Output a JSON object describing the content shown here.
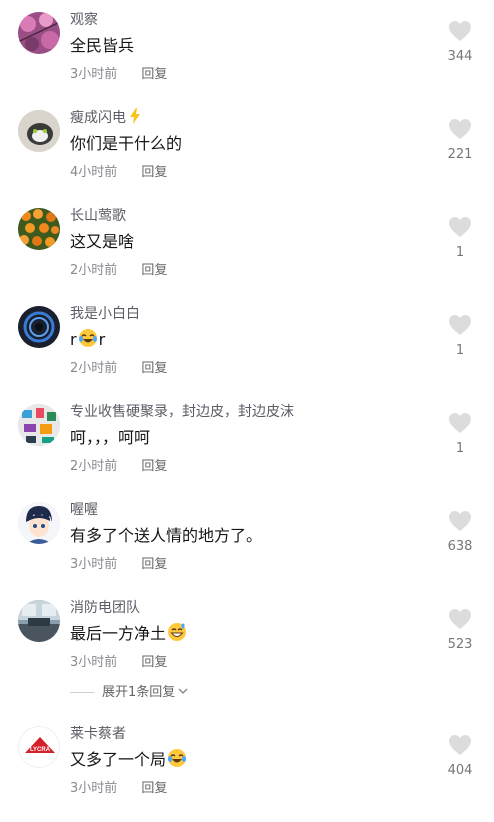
{
  "comments": [
    {
      "username": "观察",
      "text": "全民皆兵",
      "time": "3小时前",
      "reply": "回复",
      "likes": "344",
      "avatar": "pink-blossom-avatar"
    },
    {
      "username": "瘦成闪电",
      "text": "你们是干什么的",
      "time": "4小时前",
      "reply": "回复",
      "likes": "221",
      "avatar": "cat-photo-avatar",
      "badge": "lightning-icon"
    },
    {
      "username": "长山莺歌",
      "text": "这又是啥",
      "time": "2小时前",
      "reply": "回复",
      "likes": "1",
      "avatar": "orange-flowers-avatar"
    },
    {
      "username": "我是小白白",
      "text_a": "r",
      "text_b": "r",
      "time": "2小时前",
      "reply": "回复",
      "likes": "1",
      "avatar": "blue-ring-avatar",
      "emoji": "laughing-tears-emoji"
    },
    {
      "username": "专业收售硬聚录，封边皮，封边皮沫",
      "text": "呵，，，呵呵",
      "time": "2小时前",
      "reply": "回复",
      "likes": "1",
      "avatar": "colorful-items-avatar"
    },
    {
      "username": "喔喔",
      "text": "有多了个送人情的地方了。",
      "time": "3小时前",
      "reply": "回复",
      "likes": "638",
      "avatar": "anime-boy-avatar"
    },
    {
      "username": "消防电团队",
      "text": "最后一方净土",
      "time": "3小时前",
      "reply": "回复",
      "likes": "523",
      "avatar": "office-photo-avatar",
      "emoji": "grin-sweat-emoji"
    },
    {
      "username": "莱卡蔡者",
      "text": "又多了一个局",
      "time": "3小时前",
      "reply": "回复",
      "likes": "404",
      "avatar": "lycra-logo-avatar",
      "emoji": "laughing-tears-emoji",
      "logo_text": "LYCRA"
    }
  ],
  "expand_replies": "展开1条回复",
  "colors": {
    "username": "#5c5c66",
    "text": "#16161a",
    "meta": "#8a8a92",
    "heart": "#dcdcdc"
  }
}
